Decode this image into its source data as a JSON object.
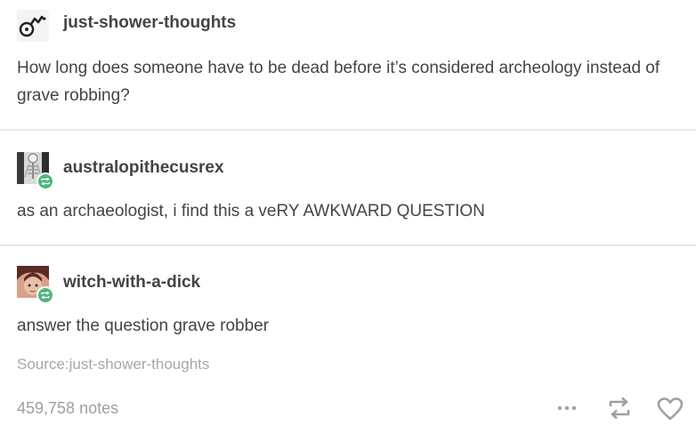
{
  "posts": [
    {
      "username": "just-shower-thoughts",
      "text": "How long does someone have to be dead before it’s considered archeology instead of grave robbing?"
    },
    {
      "username": "australopithecusrex",
      "text": "as an archaeologist, i find this a veRY AWKWARD QUESTION"
    },
    {
      "username": "witch-with-a-dick",
      "text": "answer the question grave robber"
    }
  ],
  "footer": {
    "source": "Source:just-shower-thoughts",
    "notes": "459,758 notes"
  },
  "icons": {
    "more": "more-options-icon",
    "reblog": "reblog-icon",
    "like": "heart-icon",
    "badge": "reblog-badge-icon"
  },
  "colors": {
    "text": "#444444",
    "muted": "#a7a7a7",
    "reblog_badge": "#4fb77d",
    "icon": "#a0a0a0",
    "divider": "#e7e7e7"
  }
}
